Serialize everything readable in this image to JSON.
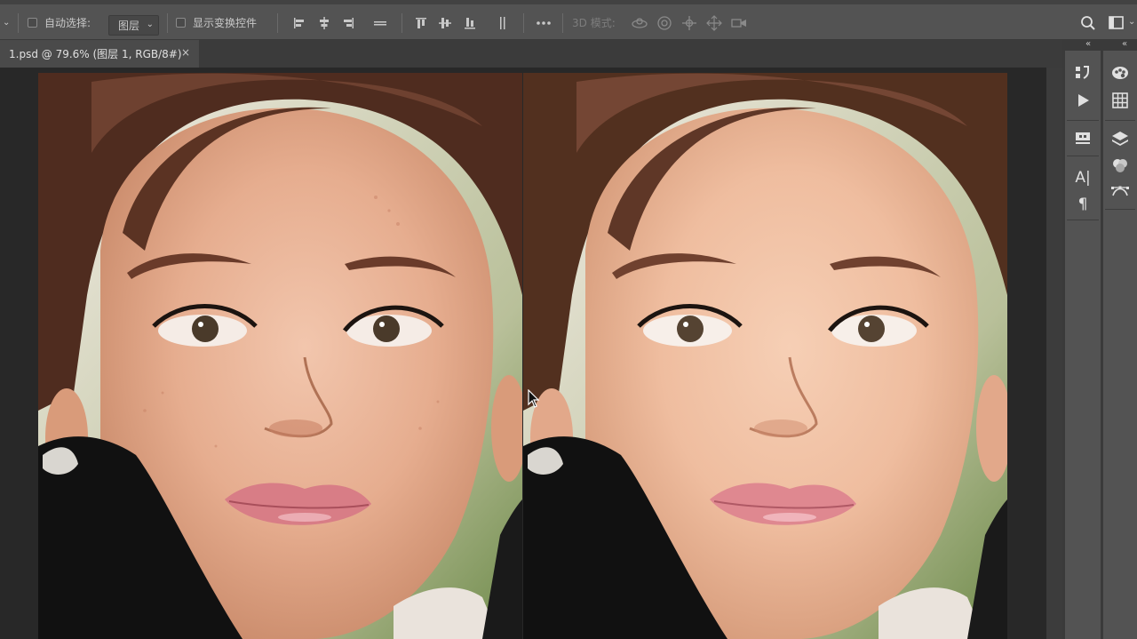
{
  "options_bar": {
    "auto_select_label": "自动选择:",
    "auto_select_target": "图层",
    "show_transform_label": "显示变换控件",
    "mode_3d_label": "3D 模式:",
    "more_icon": "ellipsis-icon",
    "align_icons": [
      "align-left-icon",
      "align-hcenter-icon",
      "align-right-icon",
      "distribute-horizontal-icon"
    ],
    "align_vertical_icons": [
      "align-top-icon",
      "align-vcenter-icon",
      "align-bottom-icon",
      "distribute-vertical-icon"
    ],
    "mode_3d_icons": [
      "orbit-3d-icon",
      "roll-3d-icon",
      "pan-3d-icon",
      "slide-3d-icon",
      "scale-3d-icon"
    ],
    "right_icons": [
      "search-icon",
      "workspace-icon"
    ]
  },
  "document_tab": {
    "title": "1.psd @ 79.6% (图层 1, RGB/8#)",
    "close": "×"
  },
  "dock": {
    "collapse_glyph": "«",
    "col1_icons": [
      "history-icon",
      "actions-play-icon",
      "properties-icon",
      "character-icon",
      "paragraph-icon"
    ],
    "col1_text": {
      "character": "A|",
      "paragraph": "¶"
    },
    "col2_icons": [
      "color-wheel-icon",
      "grid-swatches-icon",
      "layers-icon",
      "channels-icon",
      "paths-icon"
    ]
  },
  "colors": {
    "options_bar_bg": "#535353",
    "canvas_bg": "#282828",
    "skin_before": "#e9b49a",
    "skin_after": "#f0c2a4",
    "hair": "#5a3424"
  }
}
